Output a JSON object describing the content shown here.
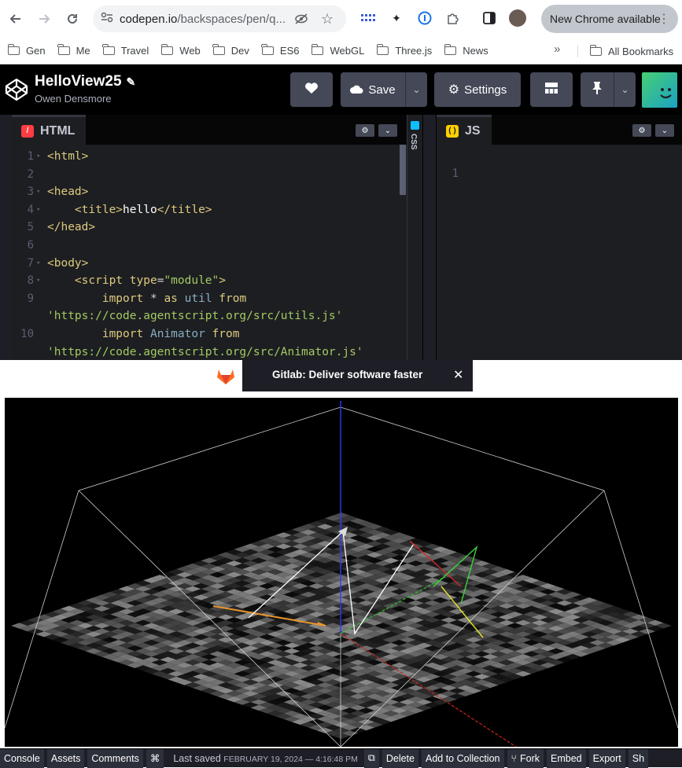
{
  "browser": {
    "url_host": "codepen.io",
    "url_path": "/backspaces/pen/q...",
    "new_chrome_label": "New Chrome available"
  },
  "bookmarks": {
    "items": [
      "Gen",
      "Me",
      "Travel",
      "Web",
      "Dev",
      "ES6",
      "WebGL",
      "Three.js",
      "News"
    ],
    "more": "»",
    "all": "All Bookmarks"
  },
  "header": {
    "title": "HelloView25",
    "author": "Owen Densmore",
    "save_label": "Save",
    "settings_label": "Settings"
  },
  "html_editor": {
    "tab_label": "HTML",
    "lines": [
      {
        "n": "1",
        "fold": true,
        "html": "<span class='tg'>&lt;html&gt;</span>"
      },
      {
        "n": "2",
        "fold": false,
        "html": ""
      },
      {
        "n": "3",
        "fold": true,
        "html": "<span class='tg'>&lt;head&gt;</span>"
      },
      {
        "n": "4",
        "fold": true,
        "html": "    <span class='tg'>&lt;title&gt;</span><span class='txt'>hello</span><span class='tg'>&lt;/title&gt;</span>"
      },
      {
        "n": "5",
        "fold": false,
        "html": "<span class='tg'>&lt;/head&gt;</span>"
      },
      {
        "n": "6",
        "fold": false,
        "html": ""
      },
      {
        "n": "7",
        "fold": true,
        "html": "<span class='tg'>&lt;body&gt;</span>"
      },
      {
        "n": "8",
        "fold": true,
        "html": "    <span class='tg'>&lt;script</span> <span class='at'>type</span>=<span class='st'>\"module\"</span><span class='tg'>&gt;</span>"
      },
      {
        "n": "9",
        "fold": false,
        "html": "        <span class='kw'>import</span> * <span class='kw'>as</span> <span class='id'>util</span> <span class='kw'>from</span>"
      },
      {
        "n": "",
        "fold": false,
        "html": "<span class='st'>'https://code.agentscript.org/src/utils.js'</span>"
      },
      {
        "n": "10",
        "fold": false,
        "html": "        <span class='kw'>import</span> <span class='id'>Animator</span> <span class='kw'>from</span>"
      },
      {
        "n": "",
        "fold": false,
        "html": "<span class='st'>'https://code.agentscript.org/src/Animator.js'</span>"
      }
    ]
  },
  "css_editor": {
    "tab_label": "CSS"
  },
  "js_editor": {
    "tab_label": "JS",
    "line_number": "1"
  },
  "ad": {
    "text": "Gitlab: Deliver software faster",
    "close": "✕"
  },
  "footer": {
    "console": "Console",
    "assets": "Assets",
    "comments": "Comments",
    "shortcut": "⌘",
    "last_saved_label": "Last saved",
    "last_saved_date": "FEBRUARY 19, 2024 — 4:16:48 PM",
    "delete": "Delete",
    "add_to_collection": "Add to Collection",
    "fork": "Fork",
    "embed": "Embed",
    "export": "Export",
    "share": "Sh"
  }
}
